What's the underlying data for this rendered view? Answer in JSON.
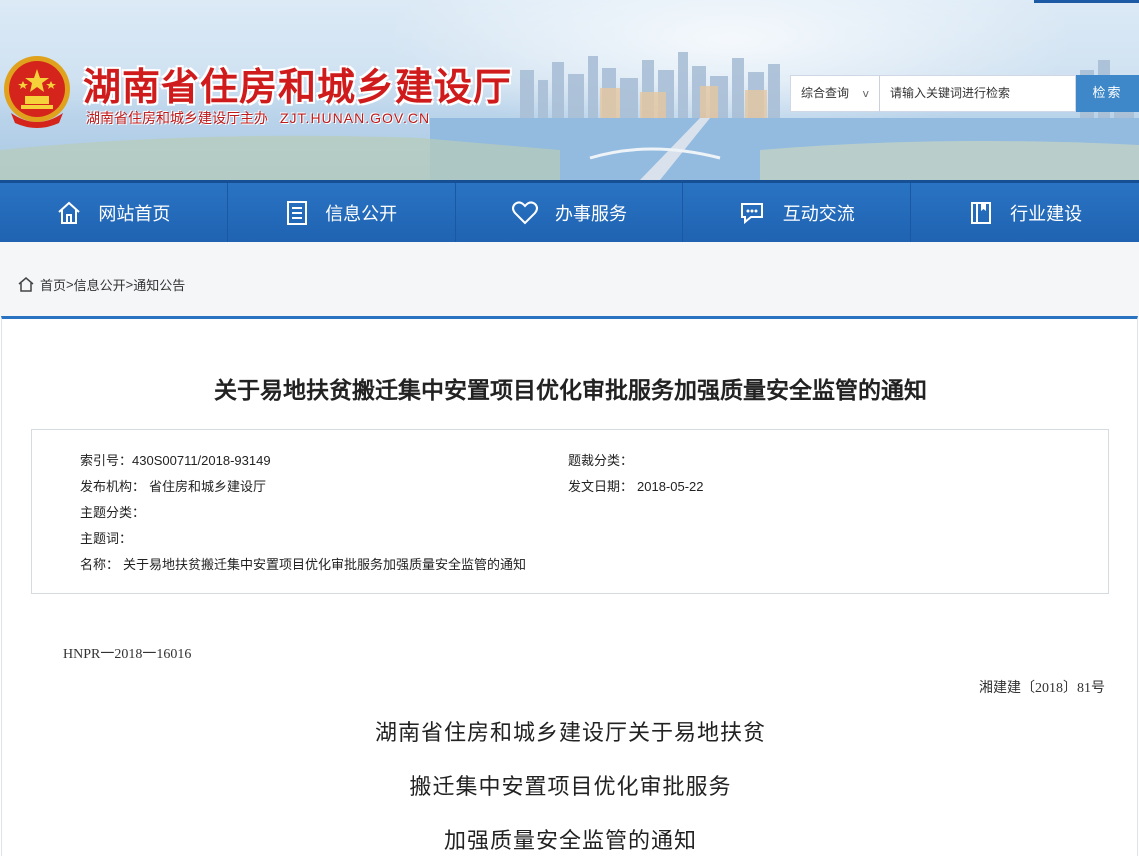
{
  "header": {
    "site_title": "湖南省住房和城乡建设厅",
    "site_subtitle": "湖南省住房和城乡建设厅主办",
    "site_url": "ZJT.HUNAN.GOV.CN"
  },
  "search": {
    "scope_selected": "综合查询",
    "scope_chevron": "v",
    "placeholder": "请输入关键词进行检索",
    "button_label": "检索"
  },
  "nav": {
    "items": [
      {
        "label": "网站首页",
        "icon": "home-icon"
      },
      {
        "label": "信息公开",
        "icon": "document-icon"
      },
      {
        "label": "办事服务",
        "icon": "heart-icon"
      },
      {
        "label": "互动交流",
        "icon": "chat-icon"
      },
      {
        "label": "行业建设",
        "icon": "book-icon"
      }
    ]
  },
  "breadcrumb": {
    "items": [
      "首页",
      "信息公开",
      "通知公告"
    ],
    "separator": ">"
  },
  "article": {
    "title": "关于易地扶贫搬迁集中安置项目优化审批服务加强质量安全监管的通知",
    "meta": {
      "index_label": "索引号：",
      "index_value": "430S00711/2018-93149",
      "genre_label": "题裁分类：",
      "genre_value": "",
      "publisher_label": "发布机构：",
      "publisher_value": "省住房和城乡建设厅",
      "date_label": "发文日期：",
      "date_value": "2018-05-22",
      "topic_label": "主题分类：",
      "topic_value": "",
      "keywords_label": "主题词：",
      "keywords_value": "",
      "name_label": "名称：",
      "name_value": "关于易地扶贫搬迁集中安置项目优化审批服务加强质量安全监管的通知"
    },
    "doc_number": "HNPR一2018一16016",
    "doc_reference": "湘建建〔2018〕81号",
    "body_title_lines": [
      "湖南省住房和城乡建设厅关于易地扶贫",
      "搬迁集中安置项目优化审批服务",
      "加强质量安全监管的通知"
    ]
  },
  "colors": {
    "brand_red": "#cf1b1b",
    "nav_blue": "#2a73c3",
    "search_button": "#3e87c8"
  }
}
